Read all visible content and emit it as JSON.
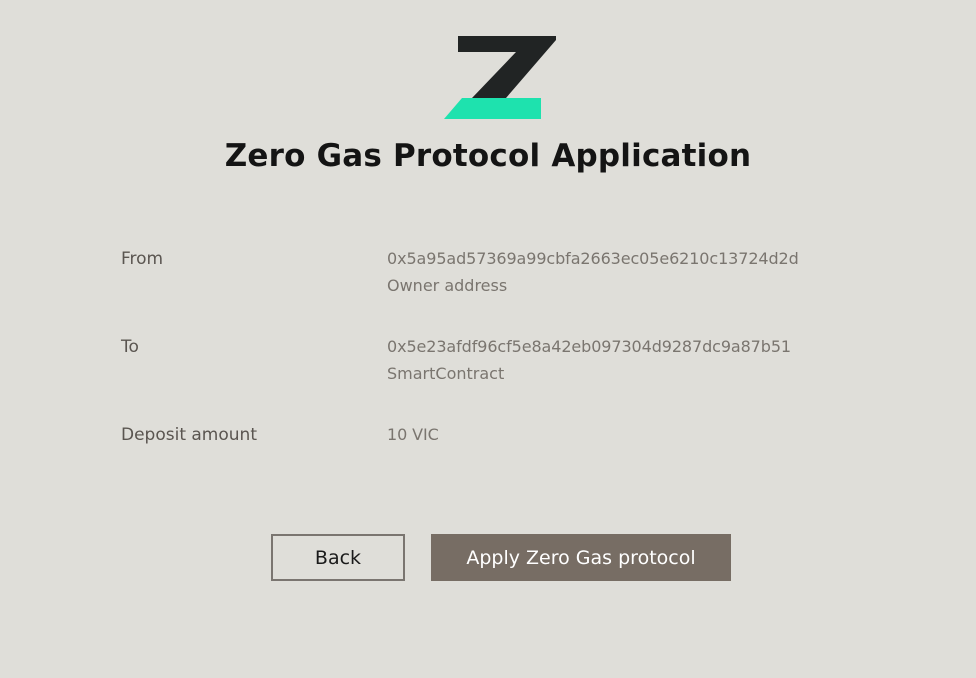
{
  "brand": {
    "logo_icon": "zero-gas-z-logo",
    "colors": {
      "logo_dark": "#212424",
      "logo_accent": "#1ee2ae",
      "background": "#dfded9",
      "primary_button": "#776d64"
    }
  },
  "page": {
    "title": "Zero Gas Protocol Application"
  },
  "details": {
    "from": {
      "label": "From",
      "value": "0x5a95ad57369a99cbfa2663ec05e6210c13724d2d",
      "sub": "Owner address"
    },
    "to": {
      "label": "To",
      "value": "0x5e23afdf96cf5e8a42eb097304d9287dc9a87b51",
      "sub": "SmartContract"
    },
    "deposit": {
      "label": "Deposit amount",
      "value": "10 VIC"
    }
  },
  "actions": {
    "back_label": "Back",
    "apply_label": "Apply Zero Gas protocol"
  }
}
